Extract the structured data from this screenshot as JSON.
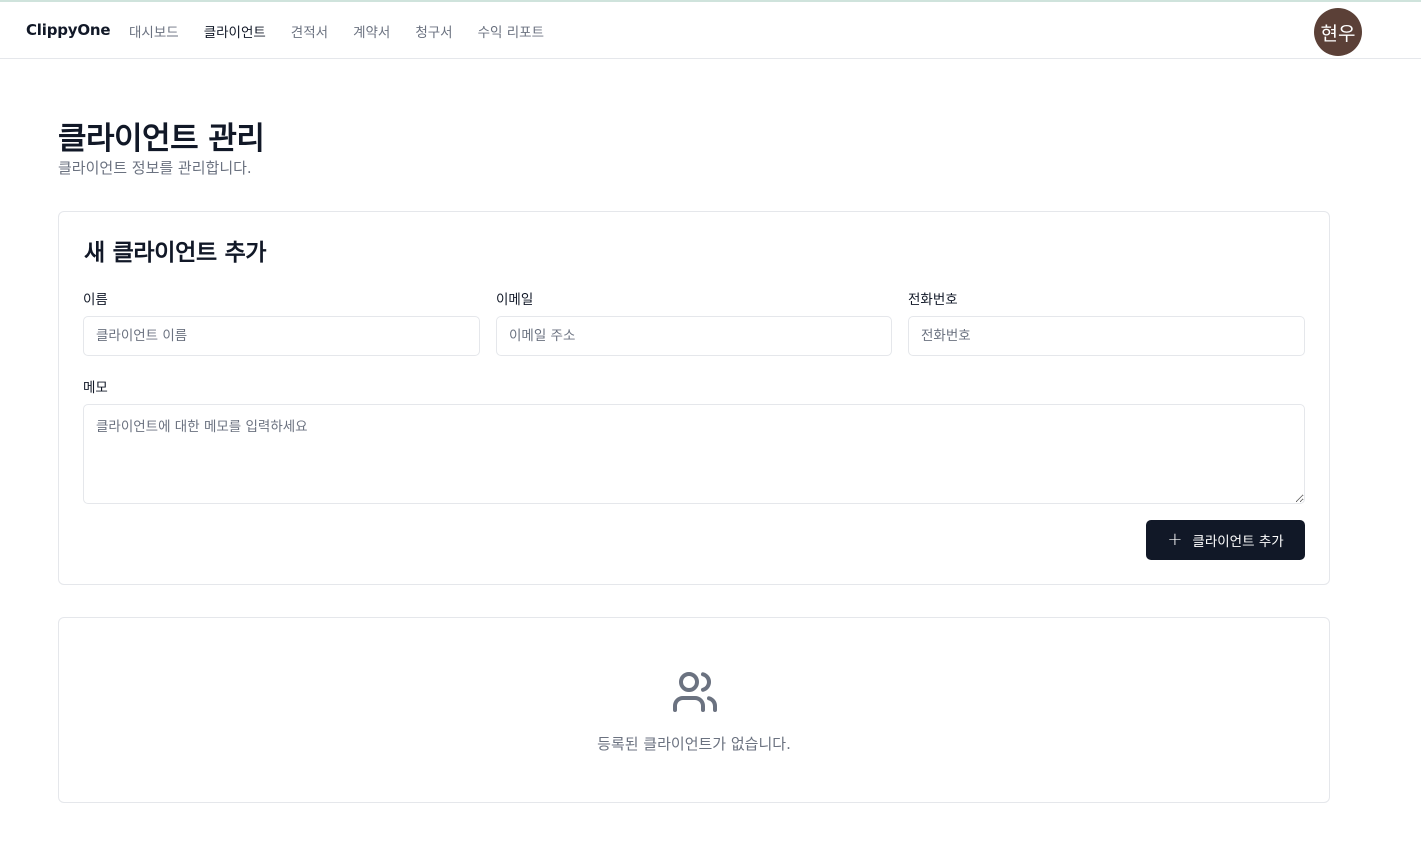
{
  "nav": {
    "brand": "ClippyOne",
    "links": [
      "대시보드",
      "클라이언트",
      "견적서",
      "계약서",
      "청구서",
      "수익 리포트"
    ],
    "active_index": 1,
    "avatar_text": "현우",
    "avatar_color": "#5b4037"
  },
  "page": {
    "title": "클라이언트 관리",
    "subtitle": "클라이언트 정보를 관리합니다."
  },
  "form": {
    "title": "새 클라이언트 추가",
    "name_label": "이름",
    "name_placeholder": "클라이언트 이름",
    "email_label": "이메일",
    "email_placeholder": "이메일 주소",
    "phone_label": "전화번호",
    "phone_placeholder": "전화번호",
    "memo_label": "메모",
    "memo_placeholder": "클라이언트에 대한 메모를 입력하세요",
    "submit_icon": "plus-icon",
    "submit_label": "클라이언트 추가",
    "accent_color": "#111827"
  },
  "empty": {
    "icon": "users-icon",
    "text": "등록된 클라이언트가 없습니다."
  }
}
